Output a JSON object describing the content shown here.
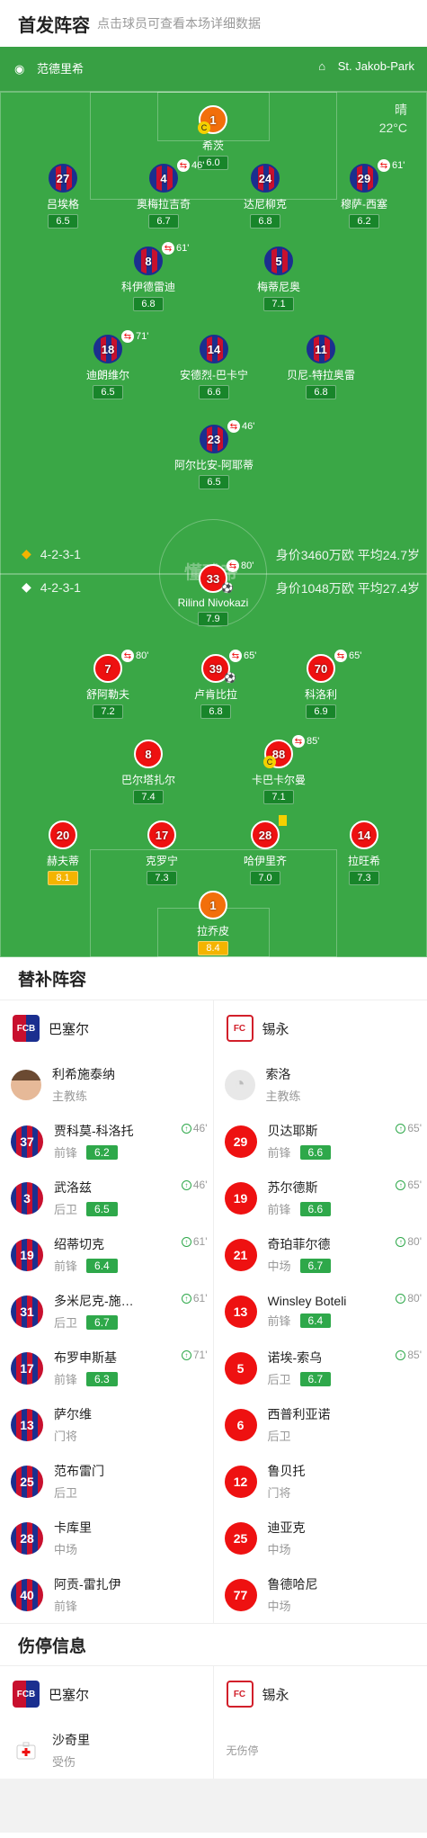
{
  "header": {
    "title": "首发阵容",
    "subtitle": "点击球员可查看本场详细数据"
  },
  "pitch": {
    "referee": "范德里希",
    "stadium": "St. Jakob-Park",
    "weather": "晴",
    "temperature": "22°C",
    "watermark": "懂球帝",
    "home": {
      "formation": "4-2-3-1",
      "value": "身价3460万欧 平均24.7岁"
    },
    "away": {
      "formation": "4-2-3-1",
      "value": "身价1048万欧 平均27.4岁"
    }
  },
  "home_players": [
    {
      "num": "1",
      "name": "希茨",
      "rating": "6.0",
      "kit": "gk",
      "captain": true
    },
    {
      "num": "27",
      "name": "吕埃格",
      "rating": "6.5",
      "kit": "blue"
    },
    {
      "num": "4",
      "name": "奥梅拉吉奇",
      "rating": "6.7",
      "kit": "blue",
      "sub": "46'"
    },
    {
      "num": "24",
      "name": "达尼柳克",
      "rating": "6.8",
      "kit": "blue"
    },
    {
      "num": "29",
      "name": "穆萨-西塞",
      "rating": "6.2",
      "kit": "blue",
      "sub": "61'"
    },
    {
      "num": "8",
      "name": "科伊德雷迪",
      "rating": "6.8",
      "kit": "blue",
      "sub": "61'"
    },
    {
      "num": "5",
      "name": "梅蒂尼奥",
      "rating": "7.1",
      "kit": "blue"
    },
    {
      "num": "18",
      "name": "迪朗维尔",
      "rating": "6.5",
      "kit": "blue",
      "sub": "71'"
    },
    {
      "num": "14",
      "name": "安德烈-巴卡宁",
      "rating": "6.6",
      "kit": "blue"
    },
    {
      "num": "11",
      "name": "贝尼-特拉奥雷",
      "rating": "6.8",
      "kit": "blue"
    },
    {
      "num": "23",
      "name": "阿尔比安-阿耶蒂",
      "rating": "6.5",
      "kit": "blue",
      "sub": "46'"
    }
  ],
  "away_players": [
    {
      "num": "33",
      "name": "Rilind Nivokazi",
      "rating": "7.9",
      "kit": "red",
      "sub": "80'",
      "ball": true
    },
    {
      "num": "7",
      "name": "舒阿勒夫",
      "rating": "7.2",
      "kit": "red",
      "sub": "80'"
    },
    {
      "num": "39",
      "name": "卢肯比拉",
      "rating": "6.8",
      "kit": "red",
      "sub": "65'",
      "ball": true
    },
    {
      "num": "70",
      "name": "科洛利",
      "rating": "6.9",
      "kit": "red",
      "sub": "65'"
    },
    {
      "num": "8",
      "name": "巴尔塔扎尔",
      "rating": "7.4",
      "kit": "red"
    },
    {
      "num": "88",
      "name": "卡巴卡尔曼",
      "rating": "7.1",
      "kit": "red",
      "sub": "85'",
      "captain": true
    },
    {
      "num": "20",
      "name": "赫夫蒂",
      "rating": "8.1",
      "kit": "red",
      "gold": true
    },
    {
      "num": "17",
      "name": "克罗宁",
      "rating": "7.3",
      "kit": "red"
    },
    {
      "num": "28",
      "name": "哈伊里齐",
      "rating": "7.0",
      "kit": "red",
      "yellow": true
    },
    {
      "num": "14",
      "name": "拉旺希",
      "rating": "7.3",
      "kit": "red"
    },
    {
      "num": "1",
      "name": "拉乔皮",
      "rating": "8.4",
      "kit": "gk",
      "gold": true
    }
  ],
  "subs": {
    "title": "替补阵容",
    "home": {
      "team": "巴塞尔",
      "coach": {
        "name": "利希施泰纳",
        "role": "主教练"
      },
      "players": [
        {
          "num": "37",
          "name": "贾科莫-科洛托",
          "pos": "前锋",
          "rating": "6.2",
          "time": "46'"
        },
        {
          "num": "3",
          "name": "武洛兹",
          "pos": "后卫",
          "rating": "6.5",
          "time": "46'"
        },
        {
          "num": "19",
          "name": "绍蒂切克",
          "pos": "前锋",
          "rating": "6.4",
          "time": "61'"
        },
        {
          "num": "31",
          "name": "多米尼克-施…",
          "pos": "后卫",
          "rating": "6.7",
          "time": "61'"
        },
        {
          "num": "17",
          "name": "布罗申斯基",
          "pos": "前锋",
          "rating": "6.3",
          "time": "71'"
        },
        {
          "num": "13",
          "name": "萨尔维",
          "pos": "门将"
        },
        {
          "num": "25",
          "name": "范布雷门",
          "pos": "后卫"
        },
        {
          "num": "28",
          "name": "卡库里",
          "pos": "中场"
        },
        {
          "num": "40",
          "name": "阿贡-雷扎伊",
          "pos": "前锋"
        }
      ]
    },
    "away": {
      "team": "锡永",
      "coach": {
        "name": "索洛",
        "role": "主教练"
      },
      "players": [
        {
          "num": "29",
          "name": "贝达耶斯",
          "pos": "前锋",
          "rating": "6.6",
          "time": "65'"
        },
        {
          "num": "19",
          "name": "苏尔德斯",
          "pos": "前锋",
          "rating": "6.6",
          "time": "65'"
        },
        {
          "num": "21",
          "name": "奇珀菲尔德",
          "pos": "中场",
          "rating": "6.7",
          "time": "80'"
        },
        {
          "num": "13",
          "name": "Winsley Boteli",
          "pos": "前锋",
          "rating": "6.4",
          "time": "80'"
        },
        {
          "num": "5",
          "name": "诺埃-索乌",
          "pos": "后卫",
          "rating": "6.7",
          "time": "85'"
        },
        {
          "num": "6",
          "name": "西普利亚诺",
          "pos": "后卫"
        },
        {
          "num": "12",
          "name": "鲁贝托",
          "pos": "门将"
        },
        {
          "num": "25",
          "name": "迪亚克",
          "pos": "中场"
        },
        {
          "num": "77",
          "name": "鲁德哈尼",
          "pos": "中场"
        }
      ]
    }
  },
  "injuries": {
    "title": "伤停信息",
    "home": {
      "team": "巴塞尔",
      "players": [
        {
          "name": "沙奇里",
          "status": "受伤"
        }
      ]
    },
    "away": {
      "team": "锡永",
      "empty": "无伤停"
    }
  }
}
